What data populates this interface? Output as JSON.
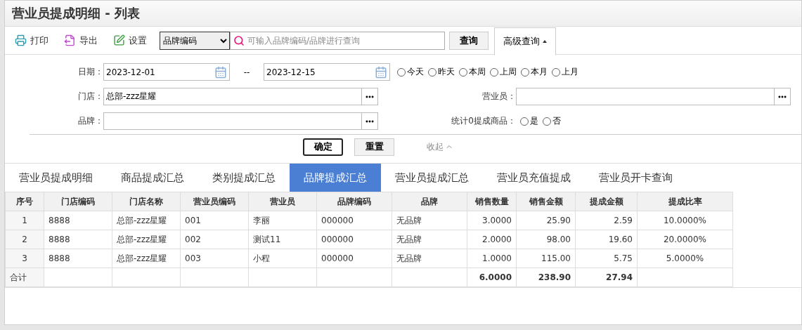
{
  "page": {
    "title": "营业员提成明细 - 列表"
  },
  "toolbar": {
    "actions": [
      {
        "label": "打印",
        "kind": "print"
      },
      {
        "label": "导出",
        "kind": "export"
      },
      {
        "label": "设置",
        "kind": "settings"
      }
    ],
    "search_type": "品牌编码",
    "search": {
      "placeholder": "可输入品牌编码/品牌进行查询"
    },
    "query_button": "查询",
    "advanced_button": "高级查询",
    "advanced_expanded": true
  },
  "filters": {
    "date": {
      "label": "日期：",
      "from": "2023-12-01",
      "separator": "--",
      "to": "2023-12-15"
    },
    "presets": [
      {
        "label": "今天",
        "selected": false
      },
      {
        "label": "昨天",
        "selected": false
      },
      {
        "label": "本周",
        "selected": false
      },
      {
        "label": "上周",
        "selected": false
      },
      {
        "label": "本月",
        "selected": false
      },
      {
        "label": "上月",
        "selected": false
      }
    ],
    "store": {
      "label": "门店：",
      "value": "总部-zzz星耀"
    },
    "staff": {
      "label": "营业员："
    },
    "brand": {
      "label": "品牌："
    },
    "zero_stat": {
      "label": "统计0提成商品：",
      "options": [
        {
          "label": "是",
          "selected": false
        },
        {
          "label": "否",
          "selected": false
        }
      ]
    },
    "confirm": "确定",
    "reset": "重置",
    "collapse": "收起"
  },
  "tabs": [
    {
      "label": "营业员提成明细",
      "selected": false
    },
    {
      "label": "商品提成汇总",
      "selected": false
    },
    {
      "label": "类别提成汇总",
      "selected": false
    },
    {
      "label": "品牌提成汇总",
      "selected": true
    },
    {
      "label": "营业员提成汇总",
      "selected": false
    },
    {
      "label": "营业员充值提成",
      "selected": false
    },
    {
      "label": "营业员开卡查询",
      "selected": false
    }
  ],
  "table": {
    "columns": [
      "序号",
      "门店编码",
      "门店名称",
      "营业员编码",
      "营业员",
      "品牌编码",
      "品牌",
      "销售数量",
      "销售金额",
      "提成金额",
      "提成比率"
    ],
    "rows": [
      [
        "1",
        "8888",
        "总部-zzz星耀",
        "001",
        "李丽",
        "000000",
        "无品牌",
        "3.0000",
        "25.90",
        "2.59",
        "10.0000%"
      ],
      [
        "2",
        "8888",
        "总部-zzz星耀",
        "002",
        "测试11",
        "000000",
        "无品牌",
        "2.0000",
        "98.00",
        "19.60",
        "20.0000%"
      ],
      [
        "3",
        "8888",
        "总部-zzz星耀",
        "003",
        "小程",
        "000000",
        "无品牌",
        "1.0000",
        "115.00",
        "5.75",
        "5.0000%"
      ]
    ],
    "total": {
      "label": "合计",
      "quantity": "6.0000",
      "sales": "238.90",
      "commission": "27.94"
    }
  }
}
